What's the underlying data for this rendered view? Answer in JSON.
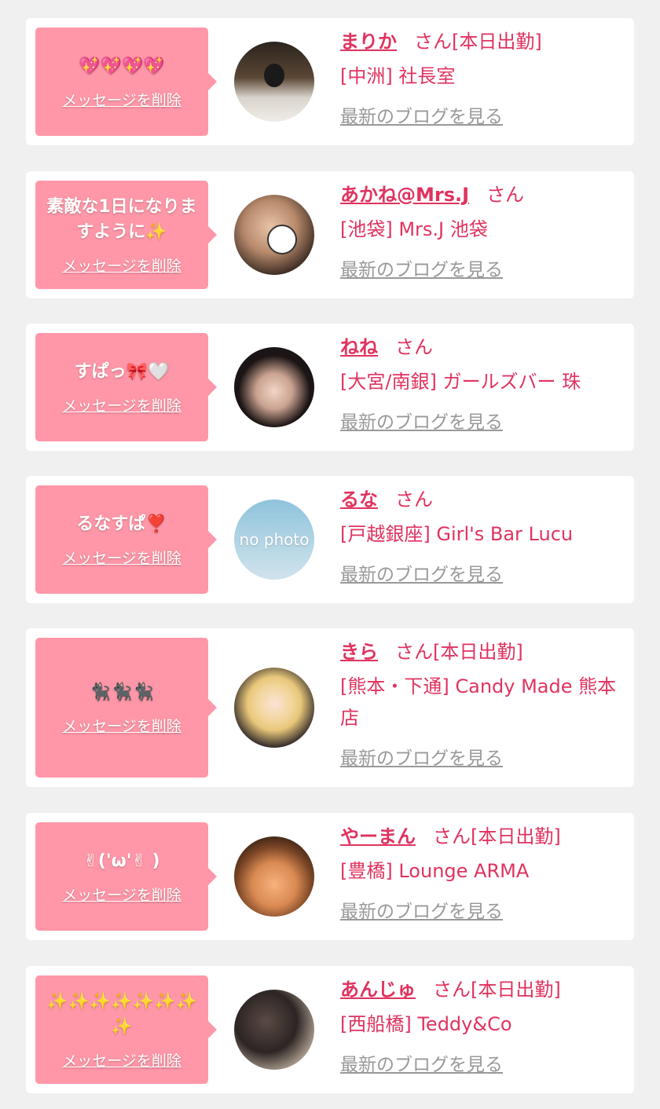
{
  "common": {
    "delete_label": "メッセージを削除",
    "blog_label": "最新のブログを見る",
    "san": "さん"
  },
  "items": [
    {
      "message": "💖💖💖💖",
      "name": "まりか",
      "status": "[本日出勤]",
      "shop": "[中洲] 社長室"
    },
    {
      "message": "素敵な1日になりますように✨",
      "name": "あかね@Mrs.J",
      "status": "",
      "shop": "[池袋] Mrs.J 池袋"
    },
    {
      "message": "すぱっ🎀🤍",
      "name": "ねね",
      "status": "",
      "shop": "[大宮/南銀] ガールズバー 珠"
    },
    {
      "message": "るなすぱ❣️",
      "name": "るな",
      "status": "",
      "shop": "[戸越銀座] Girl's Bar Lucu",
      "avatar_text": "no photo"
    },
    {
      "message": "🐈‍⬛🐈‍⬛🐈‍⬛",
      "name": "きら",
      "status": "[本日出勤]",
      "shop": "[熊本・下通] Candy Made 熊本店"
    },
    {
      "message": "✌('ω'✌ )",
      "name": "やーまん",
      "status": "[本日出勤]",
      "shop": "[豊橋] Lounge ARMA"
    },
    {
      "message": "✨✨✨✨✨✨✨✨",
      "name": "あんじゅ",
      "status": "[本日出勤]",
      "shop": "[西船橋] Teddy&Co"
    }
  ]
}
